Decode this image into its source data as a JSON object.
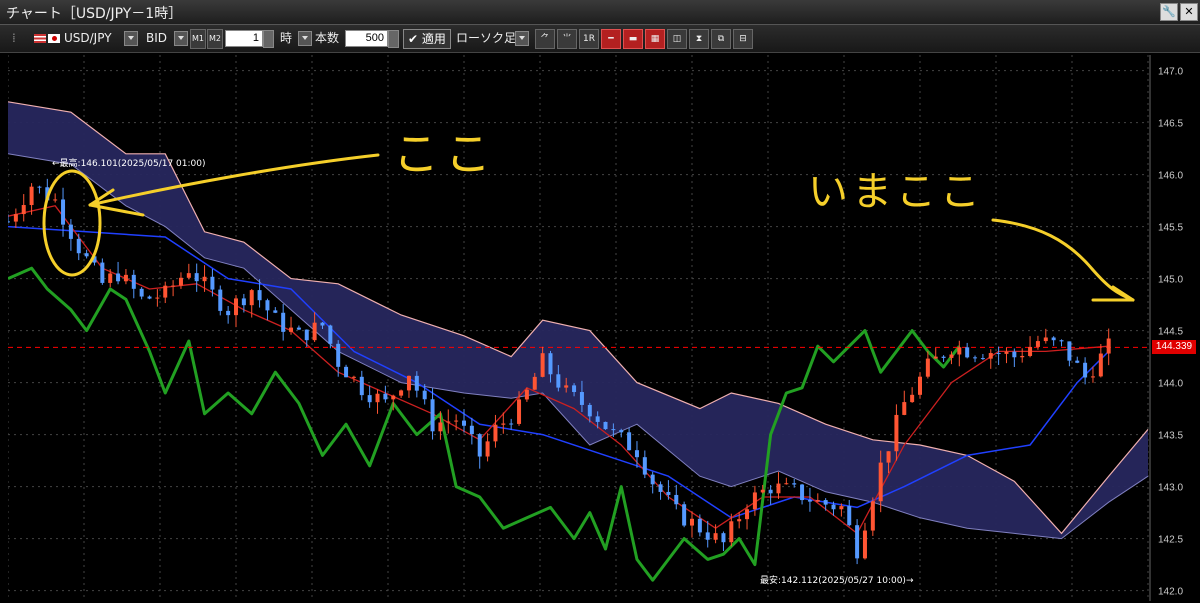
{
  "window": {
    "title": "チャート［USD/JPY－1時］",
    "wrench": "🔧",
    "close": "✕"
  },
  "toolbar": {
    "symbol": "USD/JPY",
    "price_type": "BID",
    "m1": "M1",
    "m2": "M2",
    "timeframe_value": "1",
    "timeframe_unit": "時",
    "count_label": "本数",
    "count_value": "500",
    "apply_label": "✔ 適用",
    "chart_style": "ローソク足",
    "tool_icons": [
      "trend-tool-icon",
      "fib-tool-icon",
      "1r-icon",
      "hline-icon",
      "red-bar-icon",
      "indicator-icon",
      "pin-icon",
      "measure-icon",
      "drawing-icon",
      "save-icon"
    ],
    "tool_labels": [
      "⺈",
      "⺌",
      "1R",
      "━",
      "▬",
      "▦",
      "◫",
      "⧗",
      "⧉",
      "⊟"
    ]
  },
  "colors": {
    "background": "#000000",
    "cloud": "#27275e",
    "span_a": "#f0b0b0",
    "tenkan": "#cc2020",
    "kijun": "#2040ff",
    "chikou": "#22a022",
    "up": "#ff5533",
    "down": "#5599ff",
    "current": "#ff0000",
    "annotation": "#f5cf2a"
  },
  "annotations": {
    "high_label": "←最高:146.101(2025/05/17 01:00)",
    "low_label": "最安:142.112(2025/05/27 10:00)→",
    "koko": "ここ",
    "imakoko": "いまここ"
  },
  "current_price": "144.339",
  "chart_data": {
    "type": "candlestick",
    "symbol": "USD/JPY",
    "timeframe": "1時",
    "ylim": [
      141.9,
      147.15
    ],
    "yticks": [
      "147.0",
      "146.5",
      "146.0",
      "145.5",
      "145.0",
      "144.5",
      "144.0",
      "143.5",
      "143.0",
      "142.5",
      "142.0"
    ],
    "high": 146.101,
    "high_time": "2025/05/17 01:00",
    "low": 142.112,
    "low_time": "2025/05/27 10:00",
    "current": 144.339,
    "price_path": [
      [
        0,
        145.55
      ],
      [
        3,
        145.9
      ],
      [
        6,
        145.75
      ],
      [
        9,
        145.3
      ],
      [
        12,
        144.95
      ],
      [
        14,
        145.05
      ],
      [
        17,
        144.8
      ],
      [
        20,
        144.85
      ],
      [
        23,
        145.1
      ],
      [
        26,
        144.85
      ],
      [
        28,
        144.7
      ],
      [
        31,
        144.9
      ],
      [
        34,
        144.6
      ],
      [
        37,
        144.45
      ],
      [
        40,
        144.55
      ],
      [
        42,
        144.2
      ],
      [
        45,
        143.95
      ],
      [
        48,
        143.8
      ],
      [
        51,
        144.1
      ],
      [
        54,
        143.6
      ],
      [
        57,
        143.65
      ],
      [
        60,
        143.3
      ],
      [
        62,
        143.55
      ],
      [
        65,
        143.75
      ],
      [
        68,
        144.2
      ],
      [
        71,
        143.9
      ],
      [
        74,
        143.75
      ],
      [
        77,
        143.5
      ],
      [
        80,
        143.35
      ],
      [
        82,
        143.05
      ],
      [
        85,
        142.75
      ],
      [
        88,
        142.6
      ],
      [
        91,
        142.45
      ],
      [
        94,
        142.85
      ],
      [
        97,
        143.0
      ],
      [
        100,
        142.95
      ],
      [
        103,
        142.85
      ],
      [
        106,
        142.8
      ],
      [
        108,
        142.4
      ],
      [
        111,
        143.2
      ],
      [
        114,
        143.8
      ],
      [
        117,
        144.15
      ],
      [
        120,
        144.35
      ],
      [
        123,
        144.3
      ],
      [
        125,
        144.3
      ],
      [
        128,
        144.25
      ],
      [
        131,
        144.4
      ],
      [
        134,
        144.35
      ],
      [
        137,
        144.05
      ],
      [
        140,
        144.34
      ]
    ],
    "cloud_top": [
      [
        0,
        146.7
      ],
      [
        8,
        146.6
      ],
      [
        15,
        146.2
      ],
      [
        20,
        146.2
      ],
      [
        25,
        145.45
      ],
      [
        30,
        145.35
      ],
      [
        36,
        145.0
      ],
      [
        42,
        144.95
      ],
      [
        50,
        144.65
      ],
      [
        58,
        144.45
      ],
      [
        64,
        144.25
      ],
      [
        68,
        144.6
      ],
      [
        74,
        144.5
      ],
      [
        80,
        144.0
      ],
      [
        88,
        143.75
      ],
      [
        92,
        143.9
      ],
      [
        98,
        143.8
      ],
      [
        104,
        143.6
      ],
      [
        110,
        143.45
      ],
      [
        116,
        143.4
      ],
      [
        122,
        143.3
      ],
      [
        128,
        143.05
      ],
      [
        134,
        142.55
      ],
      [
        140,
        143.1
      ],
      [
        145,
        143.55
      ]
    ],
    "cloud_bottom": [
      [
        0,
        146.2
      ],
      [
        8,
        146.1
      ],
      [
        15,
        145.7
      ],
      [
        20,
        145.5
      ],
      [
        25,
        145.2
      ],
      [
        30,
        145.1
      ],
      [
        36,
        144.7
      ],
      [
        42,
        144.3
      ],
      [
        50,
        144.0
      ],
      [
        58,
        143.9
      ],
      [
        64,
        143.85
      ],
      [
        68,
        143.9
      ],
      [
        74,
        143.4
      ],
      [
        80,
        143.6
      ],
      [
        88,
        143.1
      ],
      [
        92,
        143.0
      ],
      [
        98,
        143.15
      ],
      [
        104,
        142.95
      ],
      [
        110,
        142.85
      ],
      [
        116,
        142.7
      ],
      [
        122,
        142.6
      ],
      [
        128,
        142.55
      ],
      [
        134,
        142.5
      ],
      [
        140,
        142.85
      ],
      [
        145,
        143.1
      ]
    ],
    "tenkan": [
      [
        0,
        145.6
      ],
      [
        6,
        145.7
      ],
      [
        12,
        145.1
      ],
      [
        18,
        144.9
      ],
      [
        24,
        144.95
      ],
      [
        30,
        144.7
      ],
      [
        36,
        144.5
      ],
      [
        42,
        144.1
      ],
      [
        48,
        143.9
      ],
      [
        54,
        143.7
      ],
      [
        60,
        143.45
      ],
      [
        66,
        143.95
      ],
      [
        72,
        143.75
      ],
      [
        78,
        143.4
      ],
      [
        84,
        142.9
      ],
      [
        90,
        142.6
      ],
      [
        96,
        142.9
      ],
      [
        102,
        142.9
      ],
      [
        108,
        142.55
      ],
      [
        114,
        143.4
      ],
      [
        120,
        144.0
      ],
      [
        126,
        144.3
      ],
      [
        132,
        144.3
      ],
      [
        140,
        144.35
      ]
    ],
    "kijun": [
      [
        0,
        145.5
      ],
      [
        10,
        145.45
      ],
      [
        20,
        145.4
      ],
      [
        28,
        145.0
      ],
      [
        36,
        144.9
      ],
      [
        44,
        144.3
      ],
      [
        52,
        144.0
      ],
      [
        60,
        143.6
      ],
      [
        68,
        143.5
      ],
      [
        76,
        143.3
      ],
      [
        84,
        143.1
      ],
      [
        92,
        142.7
      ],
      [
        100,
        142.9
      ],
      [
        108,
        142.8
      ],
      [
        114,
        143.0
      ],
      [
        122,
        143.3
      ],
      [
        130,
        143.4
      ],
      [
        136,
        144.0
      ],
      [
        140,
        144.3
      ]
    ],
    "chikou": [
      [
        0,
        145.0
      ],
      [
        3,
        145.1
      ],
      [
        5,
        144.9
      ],
      [
        8,
        144.7
      ],
      [
        10,
        144.5
      ],
      [
        13,
        144.9
      ],
      [
        15,
        144.8
      ],
      [
        18,
        144.3
      ],
      [
        20,
        143.9
      ],
      [
        23,
        144.4
      ],
      [
        25,
        143.7
      ],
      [
        28,
        143.9
      ],
      [
        31,
        143.7
      ],
      [
        34,
        144.1
      ],
      [
        37,
        143.8
      ],
      [
        40,
        143.3
      ],
      [
        43,
        143.6
      ],
      [
        46,
        143.2
      ],
      [
        49,
        143.8
      ],
      [
        52,
        143.5
      ],
      [
        55,
        143.7
      ],
      [
        57,
        143.0
      ],
      [
        60,
        142.9
      ],
      [
        63,
        142.6
      ],
      [
        66,
        142.7
      ],
      [
        69,
        142.8
      ],
      [
        72,
        142.5
      ],
      [
        74,
        142.75
      ],
      [
        76,
        142.4
      ],
      [
        78,
        143.0
      ],
      [
        80,
        142.3
      ],
      [
        82,
        142.1
      ],
      [
        84,
        142.3
      ],
      [
        86,
        142.5
      ],
      [
        89,
        142.3
      ],
      [
        91,
        142.35
      ],
      [
        93,
        142.5
      ],
      [
        95,
        142.25
      ],
      [
        97,
        143.5
      ],
      [
        99,
        143.9
      ],
      [
        101,
        143.95
      ],
      [
        103,
        144.35
      ],
      [
        105,
        144.2
      ],
      [
        107,
        144.35
      ],
      [
        109,
        144.5
      ],
      [
        111,
        144.1
      ],
      [
        113,
        144.3
      ],
      [
        115,
        144.5
      ],
      [
        117,
        144.3
      ],
      [
        119,
        144.15
      ],
      [
        121,
        144.35
      ]
    ],
    "x_range": [
      0,
      145
    ]
  }
}
